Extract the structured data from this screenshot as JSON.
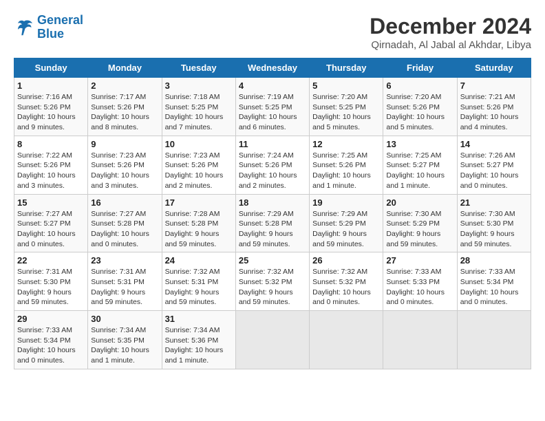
{
  "logo": {
    "line1": "General",
    "line2": "Blue"
  },
  "header": {
    "month": "December 2024",
    "location": "Qirnadah, Al Jabal al Akhdar, Libya"
  },
  "weekdays": [
    "Sunday",
    "Monday",
    "Tuesday",
    "Wednesday",
    "Thursday",
    "Friday",
    "Saturday"
  ],
  "weeks": [
    [
      {
        "day": 1,
        "sunrise": "7:16 AM",
        "sunset": "5:26 PM",
        "daylight": "10 hours and 9 minutes."
      },
      {
        "day": 2,
        "sunrise": "7:17 AM",
        "sunset": "5:26 PM",
        "daylight": "10 hours and 8 minutes."
      },
      {
        "day": 3,
        "sunrise": "7:18 AM",
        "sunset": "5:25 PM",
        "daylight": "10 hours and 7 minutes."
      },
      {
        "day": 4,
        "sunrise": "7:19 AM",
        "sunset": "5:25 PM",
        "daylight": "10 hours and 6 minutes."
      },
      {
        "day": 5,
        "sunrise": "7:20 AM",
        "sunset": "5:25 PM",
        "daylight": "10 hours and 5 minutes."
      },
      {
        "day": 6,
        "sunrise": "7:20 AM",
        "sunset": "5:26 PM",
        "daylight": "10 hours and 5 minutes."
      },
      {
        "day": 7,
        "sunrise": "7:21 AM",
        "sunset": "5:26 PM",
        "daylight": "10 hours and 4 minutes."
      }
    ],
    [
      {
        "day": 8,
        "sunrise": "7:22 AM",
        "sunset": "5:26 PM",
        "daylight": "10 hours and 3 minutes."
      },
      {
        "day": 9,
        "sunrise": "7:23 AM",
        "sunset": "5:26 PM",
        "daylight": "10 hours and 3 minutes."
      },
      {
        "day": 10,
        "sunrise": "7:23 AM",
        "sunset": "5:26 PM",
        "daylight": "10 hours and 2 minutes."
      },
      {
        "day": 11,
        "sunrise": "7:24 AM",
        "sunset": "5:26 PM",
        "daylight": "10 hours and 2 minutes."
      },
      {
        "day": 12,
        "sunrise": "7:25 AM",
        "sunset": "5:26 PM",
        "daylight": "10 hours and 1 minute."
      },
      {
        "day": 13,
        "sunrise": "7:25 AM",
        "sunset": "5:27 PM",
        "daylight": "10 hours and 1 minute."
      },
      {
        "day": 14,
        "sunrise": "7:26 AM",
        "sunset": "5:27 PM",
        "daylight": "10 hours and 0 minutes."
      }
    ],
    [
      {
        "day": 15,
        "sunrise": "7:27 AM",
        "sunset": "5:27 PM",
        "daylight": "10 hours and 0 minutes."
      },
      {
        "day": 16,
        "sunrise": "7:27 AM",
        "sunset": "5:28 PM",
        "daylight": "10 hours and 0 minutes."
      },
      {
        "day": 17,
        "sunrise": "7:28 AM",
        "sunset": "5:28 PM",
        "daylight": "9 hours and 59 minutes."
      },
      {
        "day": 18,
        "sunrise": "7:29 AM",
        "sunset": "5:28 PM",
        "daylight": "9 hours and 59 minutes."
      },
      {
        "day": 19,
        "sunrise": "7:29 AM",
        "sunset": "5:29 PM",
        "daylight": "9 hours and 59 minutes."
      },
      {
        "day": 20,
        "sunrise": "7:30 AM",
        "sunset": "5:29 PM",
        "daylight": "9 hours and 59 minutes."
      },
      {
        "day": 21,
        "sunrise": "7:30 AM",
        "sunset": "5:30 PM",
        "daylight": "9 hours and 59 minutes."
      }
    ],
    [
      {
        "day": 22,
        "sunrise": "7:31 AM",
        "sunset": "5:30 PM",
        "daylight": "9 hours and 59 minutes."
      },
      {
        "day": 23,
        "sunrise": "7:31 AM",
        "sunset": "5:31 PM",
        "daylight": "9 hours and 59 minutes."
      },
      {
        "day": 24,
        "sunrise": "7:32 AM",
        "sunset": "5:31 PM",
        "daylight": "9 hours and 59 minutes."
      },
      {
        "day": 25,
        "sunrise": "7:32 AM",
        "sunset": "5:32 PM",
        "daylight": "9 hours and 59 minutes."
      },
      {
        "day": 26,
        "sunrise": "7:32 AM",
        "sunset": "5:32 PM",
        "daylight": "10 hours and 0 minutes."
      },
      {
        "day": 27,
        "sunrise": "7:33 AM",
        "sunset": "5:33 PM",
        "daylight": "10 hours and 0 minutes."
      },
      {
        "day": 28,
        "sunrise": "7:33 AM",
        "sunset": "5:34 PM",
        "daylight": "10 hours and 0 minutes."
      }
    ],
    [
      {
        "day": 29,
        "sunrise": "7:33 AM",
        "sunset": "5:34 PM",
        "daylight": "10 hours and 0 minutes."
      },
      {
        "day": 30,
        "sunrise": "7:34 AM",
        "sunset": "5:35 PM",
        "daylight": "10 hours and 1 minute."
      },
      {
        "day": 31,
        "sunrise": "7:34 AM",
        "sunset": "5:36 PM",
        "daylight": "10 hours and 1 minute."
      },
      null,
      null,
      null,
      null
    ]
  ]
}
